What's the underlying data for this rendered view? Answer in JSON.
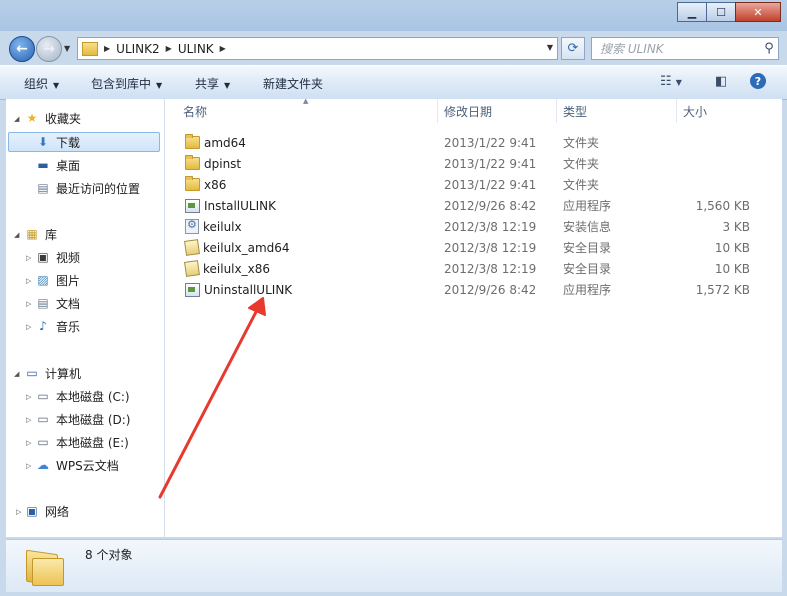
{
  "window": {
    "controls": {
      "minimize": "▁",
      "maximize": "☐",
      "close": "✕"
    }
  },
  "address": {
    "crumbs": [
      "ULINK2",
      "ULINK"
    ],
    "search_placeholder": "搜索 ULINK"
  },
  "toolbar": {
    "organize": "组织",
    "include_in_library": "包含到库中",
    "share": "共享",
    "new_folder": "新建文件夹"
  },
  "sidebar": {
    "favorites": {
      "label": "收藏夹",
      "items": [
        "下载",
        "桌面",
        "最近访问的位置"
      ]
    },
    "libraries": {
      "label": "库",
      "items": [
        "视频",
        "图片",
        "文档",
        "音乐"
      ]
    },
    "computer": {
      "label": "计算机",
      "items": [
        "本地磁盘 (C:)",
        "本地磁盘 (D:)",
        "本地磁盘 (E:)",
        "WPS云文档"
      ]
    },
    "network": {
      "label": "网络"
    }
  },
  "columns": {
    "name": "名称",
    "date": "修改日期",
    "type": "类型",
    "size": "大小"
  },
  "files": [
    {
      "name": "amd64",
      "date": "2013/1/22 9:41",
      "type": "文件夹",
      "size": "",
      "icon": "folder"
    },
    {
      "name": "dpinst",
      "date": "2013/1/22 9:41",
      "type": "文件夹",
      "size": "",
      "icon": "folder"
    },
    {
      "name": "x86",
      "date": "2013/1/22 9:41",
      "type": "文件夹",
      "size": "",
      "icon": "folder"
    },
    {
      "name": "InstallULINK",
      "date": "2012/9/26 8:42",
      "type": "应用程序",
      "size": "1,560 KB",
      "icon": "app"
    },
    {
      "name": "keilulx",
      "date": "2012/3/8 12:19",
      "type": "安装信息",
      "size": "3 KB",
      "icon": "setup"
    },
    {
      "name": "keilulx_amd64",
      "date": "2012/3/8 12:19",
      "type": "安全目录",
      "size": "10 KB",
      "icon": "catalog"
    },
    {
      "name": "keilulx_x86",
      "date": "2012/3/8 12:19",
      "type": "安全目录",
      "size": "10 KB",
      "icon": "catalog"
    },
    {
      "name": "UninstallULINK",
      "date": "2012/9/26 8:42",
      "type": "应用程序",
      "size": "1,572 KB",
      "icon": "app"
    }
  ],
  "status": {
    "count": "8 个对象"
  },
  "colors": {
    "annotation_arrow": "#e8392f",
    "selection": "#cfe4fa",
    "chrome": "#c9d9ec"
  }
}
